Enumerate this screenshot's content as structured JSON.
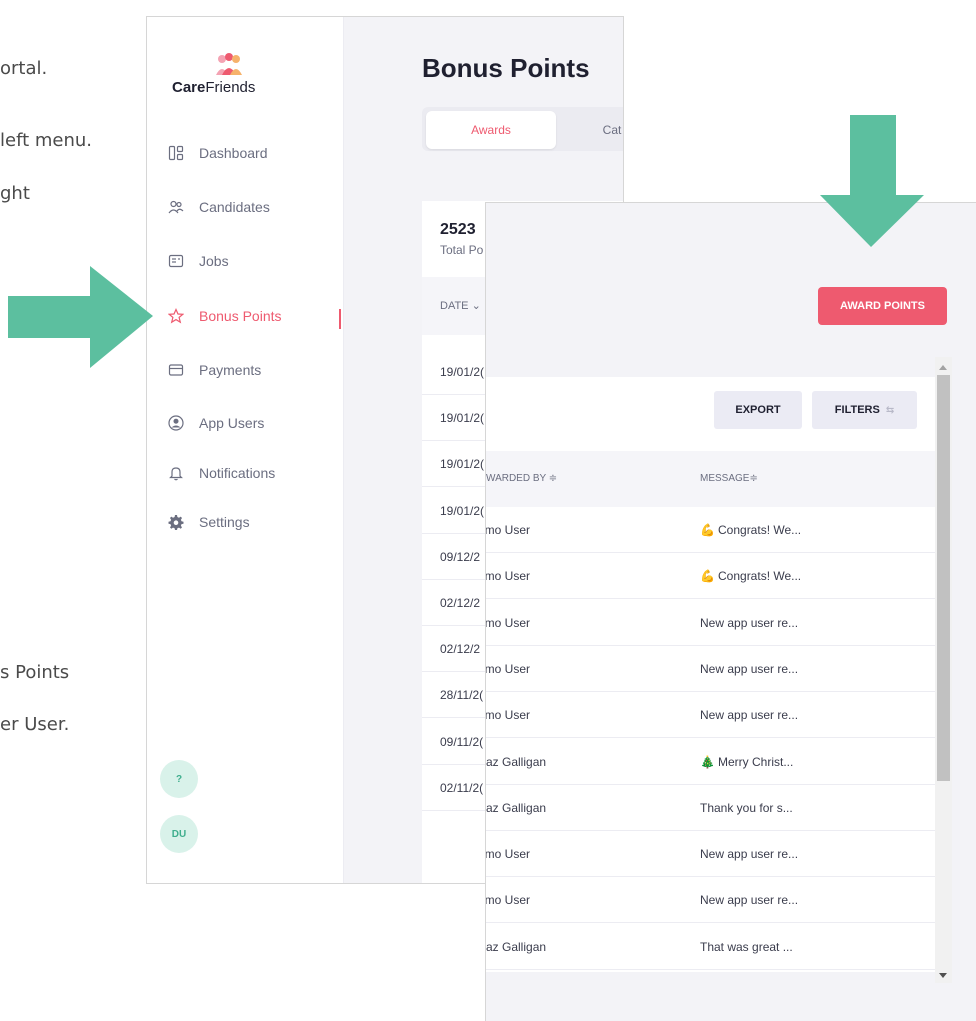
{
  "background_text": [
    "ortal.",
    "left menu.",
    "ght",
    "s Points",
    "er User."
  ],
  "colors": {
    "accent": "#ee5a6f",
    "teal_arrow": "#5cbf9f",
    "help_circle": "#d9f2ea"
  },
  "brand": {
    "name_bold": "Care",
    "name_rest": "Friends"
  },
  "sidebar": {
    "items": [
      {
        "label": "Dashboard",
        "icon": "dashboard-icon"
      },
      {
        "label": "Candidates",
        "icon": "users-icon"
      },
      {
        "label": "Jobs",
        "icon": "jobs-icon"
      },
      {
        "label": "Bonus Points",
        "icon": "star-icon",
        "active": true
      },
      {
        "label": "Payments",
        "icon": "card-icon"
      },
      {
        "label": "App Users",
        "icon": "user-circle-icon"
      },
      {
        "label": "Notifications",
        "icon": "bell-icon"
      },
      {
        "label": "Settings",
        "icon": "gear-icon"
      }
    ],
    "help_label": "?",
    "avatar_initials": "DU"
  },
  "main": {
    "title": "Bonus Points",
    "tabs": [
      "Awards",
      "Cat"
    ],
    "total_points": "2523",
    "total_label": "Total Po",
    "date_header": "DATE",
    "dates": [
      "19/01/2(",
      "19/01/2(",
      "19/01/2(",
      "19/01/2(",
      "09/12/2",
      "02/12/2",
      "02/12/2",
      "28/11/2(",
      "09/11/2(",
      "02/11/2("
    ]
  },
  "award_panel": {
    "award_button": "AWARD POINTS",
    "export_button": "EXPORT",
    "filters_button": "FILTERS",
    "headers": {
      "awarded_by": "WARDED BY ≑",
      "message": "MESSAGE≑"
    },
    "rows": [
      {
        "awarded_by": "emo User",
        "emoji": "💪",
        "message": "Congrats! We..."
      },
      {
        "awarded_by": "emo User",
        "emoji": "💪",
        "message": "Congrats! We..."
      },
      {
        "awarded_by": "emo User",
        "emoji": "",
        "message": "New app user re..."
      },
      {
        "awarded_by": "emo User",
        "emoji": "",
        "message": "New app user re..."
      },
      {
        "awarded_by": "emo User",
        "emoji": "",
        "message": "New app user re..."
      },
      {
        "awarded_by": "Aaz Galligan",
        "emoji": "🎄",
        "message": "Merry Christ..."
      },
      {
        "awarded_by": "Aaz Galligan",
        "emoji": "",
        "message": "Thank you for s..."
      },
      {
        "awarded_by": "emo User",
        "emoji": "",
        "message": "New app user re..."
      },
      {
        "awarded_by": "emo User",
        "emoji": "",
        "message": "New app user re..."
      },
      {
        "awarded_by": "Aaz Galligan",
        "emoji": "",
        "message": "That was great ..."
      }
    ]
  }
}
